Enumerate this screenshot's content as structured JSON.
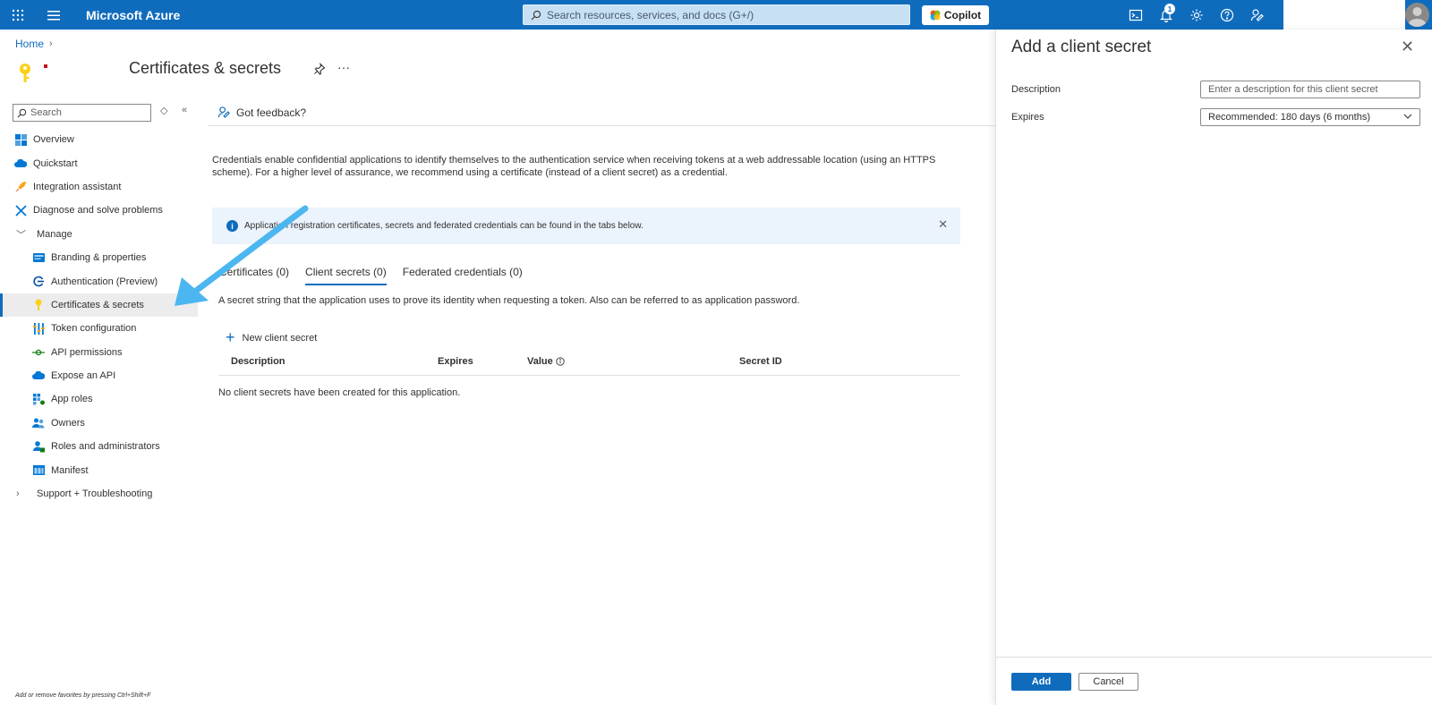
{
  "topbar": {
    "brand": "Microsoft Azure",
    "search_placeholder": "Search resources, services, and docs (G+/)",
    "copilot_label": "Copilot",
    "notification_count": "1",
    "accent_color": "#0f6cbd"
  },
  "breadcrumb": {
    "home": "Home"
  },
  "page": {
    "title": "Certificates & secrets"
  },
  "sidebar": {
    "search_placeholder": "Search",
    "items": [
      {
        "label": "Overview",
        "icon": "overview-icon"
      },
      {
        "label": "Quickstart",
        "icon": "quickstart-cloud-icon"
      },
      {
        "label": "Integration assistant",
        "icon": "rocket-icon"
      },
      {
        "label": "Diagnose and solve problems",
        "icon": "wrench-icon"
      }
    ],
    "manage_label": "Manage",
    "manage_items": [
      {
        "label": "Branding & properties",
        "icon": "branding-icon"
      },
      {
        "label": "Authentication (Preview)",
        "icon": "authentication-icon"
      },
      {
        "label": "Certificates & secrets",
        "icon": "key-icon"
      },
      {
        "label": "Token configuration",
        "icon": "token-icon"
      },
      {
        "label": "API permissions",
        "icon": "api-permissions-icon"
      },
      {
        "label": "Expose an API",
        "icon": "cloud-icon"
      },
      {
        "label": "App roles",
        "icon": "app-roles-icon"
      },
      {
        "label": "Owners",
        "icon": "owners-icon"
      },
      {
        "label": "Roles and administrators",
        "icon": "roles-icon"
      },
      {
        "label": "Manifest",
        "icon": "manifest-icon"
      }
    ],
    "support_label": "Support + Troubleshooting",
    "footer_hint": "Add or remove favorites by pressing Ctrl+Shift+F"
  },
  "main": {
    "feedback_label": "Got feedback?",
    "description": "Credentials enable confidential applications to identify themselves to the authentication service when receiving tokens at a web addressable location (using an HTTPS scheme). For a higher level of assurance, we recommend using a certificate (instead of a client secret) as a credential.",
    "info_message": "Application registration certificates, secrets and federated credentials can be found in the tabs below.",
    "tabs": [
      {
        "label": "Certificates (0)"
      },
      {
        "label": "Client secrets (0)"
      },
      {
        "label": "Federated credentials (0)"
      }
    ],
    "secret_description": "A secret string that the application uses to prove its identity when requesting a token. Also can be referred to as application password.",
    "new_secret_label": "New client secret",
    "columns": [
      "Description",
      "Expires",
      "Value",
      "Secret ID"
    ],
    "empty_message": "No client secrets have been created for this application."
  },
  "panel": {
    "title": "Add a client secret",
    "description_label": "Description",
    "description_placeholder": "Enter a description for this client secret",
    "expires_label": "Expires",
    "expires_value": "Recommended: 180 days (6 months)",
    "add_label": "Add",
    "cancel_label": "Cancel"
  }
}
